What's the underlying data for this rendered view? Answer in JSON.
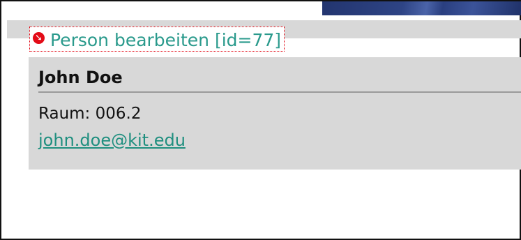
{
  "header": {
    "edit_link_label": "Person bearbeiten [id=77]",
    "edit_icon": "arrow-circle-icon"
  },
  "person": {
    "name": "John Doe",
    "room": "Raum: 006.2",
    "email": "john.doe@kit.edu"
  },
  "colors": {
    "link": "#2a9a8c",
    "icon": "#e30b17",
    "panel": "#d8d8d8"
  }
}
